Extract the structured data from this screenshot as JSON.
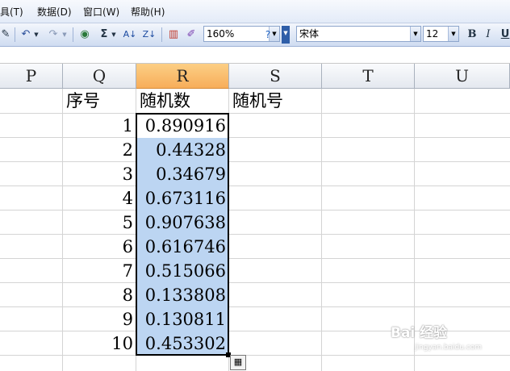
{
  "menu": {
    "items": [
      "工具(T)",
      "数据(D)",
      "窗口(W)",
      "帮助(H)"
    ],
    "visible_items": [
      "具(T)",
      "数据(D)",
      "窗口(W)",
      "帮助(H)"
    ]
  },
  "toolbar": {
    "undo_icon": "undo-icon",
    "redo_icon": "redo-icon",
    "sum_label": "Σ",
    "zoom": "160%",
    "font_name": "宋体",
    "font_size": "12",
    "bold_label": "B",
    "italic_label": "I"
  },
  "columns": [
    "P",
    "Q",
    "R",
    "S",
    "T",
    "U"
  ],
  "active_column": "R",
  "headers": {
    "q": "序号",
    "r": "随机数",
    "s": "随机号"
  },
  "rows": [
    {
      "index": "1",
      "value": "0.890916"
    },
    {
      "index": "2",
      "value": "0.44328"
    },
    {
      "index": "3",
      "value": "0.34679"
    },
    {
      "index": "4",
      "value": "0.673116"
    },
    {
      "index": "5",
      "value": "0.907638"
    },
    {
      "index": "6",
      "value": "0.616746"
    },
    {
      "index": "7",
      "value": "0.515066"
    },
    {
      "index": "8",
      "value": "0.133808"
    },
    {
      "index": "9",
      "value": "0.130811"
    },
    {
      "index": "10",
      "value": "0.453302"
    }
  ],
  "colors": {
    "selection": "#bcd5f2",
    "active_header": "#f7ad5a"
  },
  "watermark": {
    "brand": "Bai 经验",
    "sub": "jingyan.baidu.com"
  }
}
